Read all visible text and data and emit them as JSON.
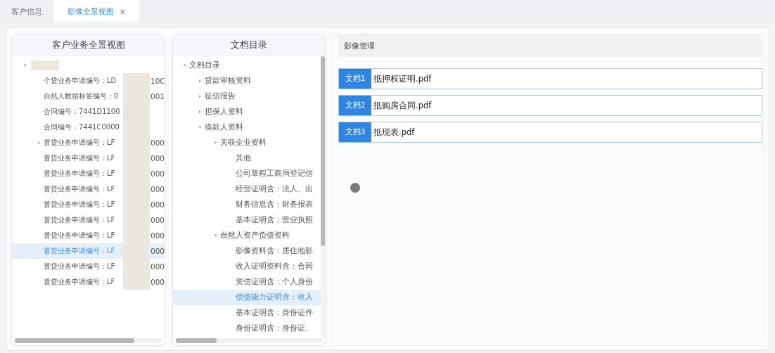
{
  "tabs": [
    {
      "label": "客户信息",
      "selected": false
    },
    {
      "label": "影像全景视图",
      "selected": true,
      "close": "×"
    }
  ],
  "customer_panel": {
    "title": "客户业务全景视图",
    "tree": [
      {
        "kind": "branch",
        "expanded": true,
        "redacted": true,
        "selected": false,
        "children": [
          {
            "kind": "leaf",
            "label": "个贷业务申请编号：LD",
            "tail": "10C",
            "redacted": true,
            "selected": false
          },
          {
            "kind": "leaf",
            "label": "自然人数据标签编号：0",
            "tail": "001",
            "redacted": true,
            "selected": false
          },
          {
            "kind": "leaf",
            "label": "合同编号：7441D1100",
            "redacted": true,
            "selected": false
          },
          {
            "kind": "leaf",
            "label": "合同编号：7441C0000",
            "redacted": true,
            "selected": false
          },
          {
            "kind": "branch",
            "expanded": false,
            "label": "普贷业务申请编号：LF",
            "tail": "000",
            "redacted": true,
            "selected": false
          },
          {
            "kind": "leaf",
            "label": "普贷业务申请编号：LF",
            "tail": "000",
            "redacted": true,
            "selected": false
          },
          {
            "kind": "leaf",
            "label": "普贷业务申请编号：LF",
            "tail": "000",
            "redacted": true,
            "selected": false
          },
          {
            "kind": "leaf",
            "label": "普贷业务申请编号：LF",
            "tail": "000",
            "redacted": true,
            "selected": false
          },
          {
            "kind": "leaf",
            "label": "普贷业务申请编号：LF",
            "tail": "000",
            "redacted": true,
            "selected": false
          },
          {
            "kind": "leaf",
            "label": "普贷业务申请编号：LF",
            "tail": "000",
            "redacted": true,
            "selected": false
          },
          {
            "kind": "leaf",
            "label": "普贷业务申请编号：LF",
            "tail": "000",
            "redacted": true,
            "selected": false
          },
          {
            "kind": "leaf",
            "label": "普贷业务申请编号：LF",
            "tail": "000",
            "redacted": true,
            "selected": true
          },
          {
            "kind": "leaf",
            "label": "普贷业务申请编号：LF",
            "tail": "000",
            "redacted": true,
            "selected": false
          },
          {
            "kind": "leaf",
            "label": "普贷业务申请编号：LF",
            "tail": "000",
            "redacted": true,
            "selected": false
          }
        ]
      }
    ]
  },
  "document_panel": {
    "title": "文档目录",
    "tree": [
      {
        "kind": "branch",
        "expanded": true,
        "label": "文档目录",
        "selected": false,
        "children": [
          {
            "kind": "branch",
            "expanded": false,
            "label": "贷款审核资料",
            "selected": false
          },
          {
            "kind": "branch",
            "expanded": false,
            "label": "征信报告",
            "selected": false
          },
          {
            "kind": "branch",
            "expanded": false,
            "label": "担保人资料",
            "selected": false
          },
          {
            "kind": "branch",
            "expanded": true,
            "label": "借款人资料",
            "selected": false,
            "children": [
              {
                "kind": "branch",
                "expanded": true,
                "label": "关联企业资料",
                "selected": false,
                "children": [
                  {
                    "kind": "leaf",
                    "label": "其他",
                    "selected": false
                  },
                  {
                    "kind": "leaf",
                    "label": "公司章程工商局登记信",
                    "selected": false
                  },
                  {
                    "kind": "leaf",
                    "label": "经营证明含：法人、出",
                    "selected": false
                  },
                  {
                    "kind": "leaf",
                    "label": "财务信息含：财务报表",
                    "selected": false
                  },
                  {
                    "kind": "leaf",
                    "label": "基本证明含：营业执照",
                    "selected": false
                  }
                ]
              },
              {
                "kind": "branch",
                "expanded": true,
                "label": "自然人资产负债资料",
                "selected": false,
                "children": [
                  {
                    "kind": "leaf",
                    "label": "影像资料含：居住地影",
                    "selected": false
                  },
                  {
                    "kind": "leaf",
                    "label": "收入证明资料含：合同",
                    "selected": false
                  },
                  {
                    "kind": "leaf",
                    "label": "资信证明含：个人身份",
                    "selected": false
                  },
                  {
                    "kind": "leaf",
                    "label": "偿债能力证明含：收入",
                    "selected": true
                  },
                  {
                    "kind": "leaf",
                    "label": "基本证明含：身份证件",
                    "selected": false
                  },
                  {
                    "kind": "leaf",
                    "label": "身份证明含：身份证、",
                    "selected": false
                  }
                ]
              }
            ]
          }
        ]
      }
    ]
  },
  "image_panel": {
    "title": "影像管理",
    "files": [
      {
        "tag": "文档1",
        "name": "抵押权证明.pdf"
      },
      {
        "tag": "文档2",
        "name": "抵购房合同.pdf"
      },
      {
        "tag": "文档3",
        "name": "抵现表.pdf"
      }
    ]
  }
}
